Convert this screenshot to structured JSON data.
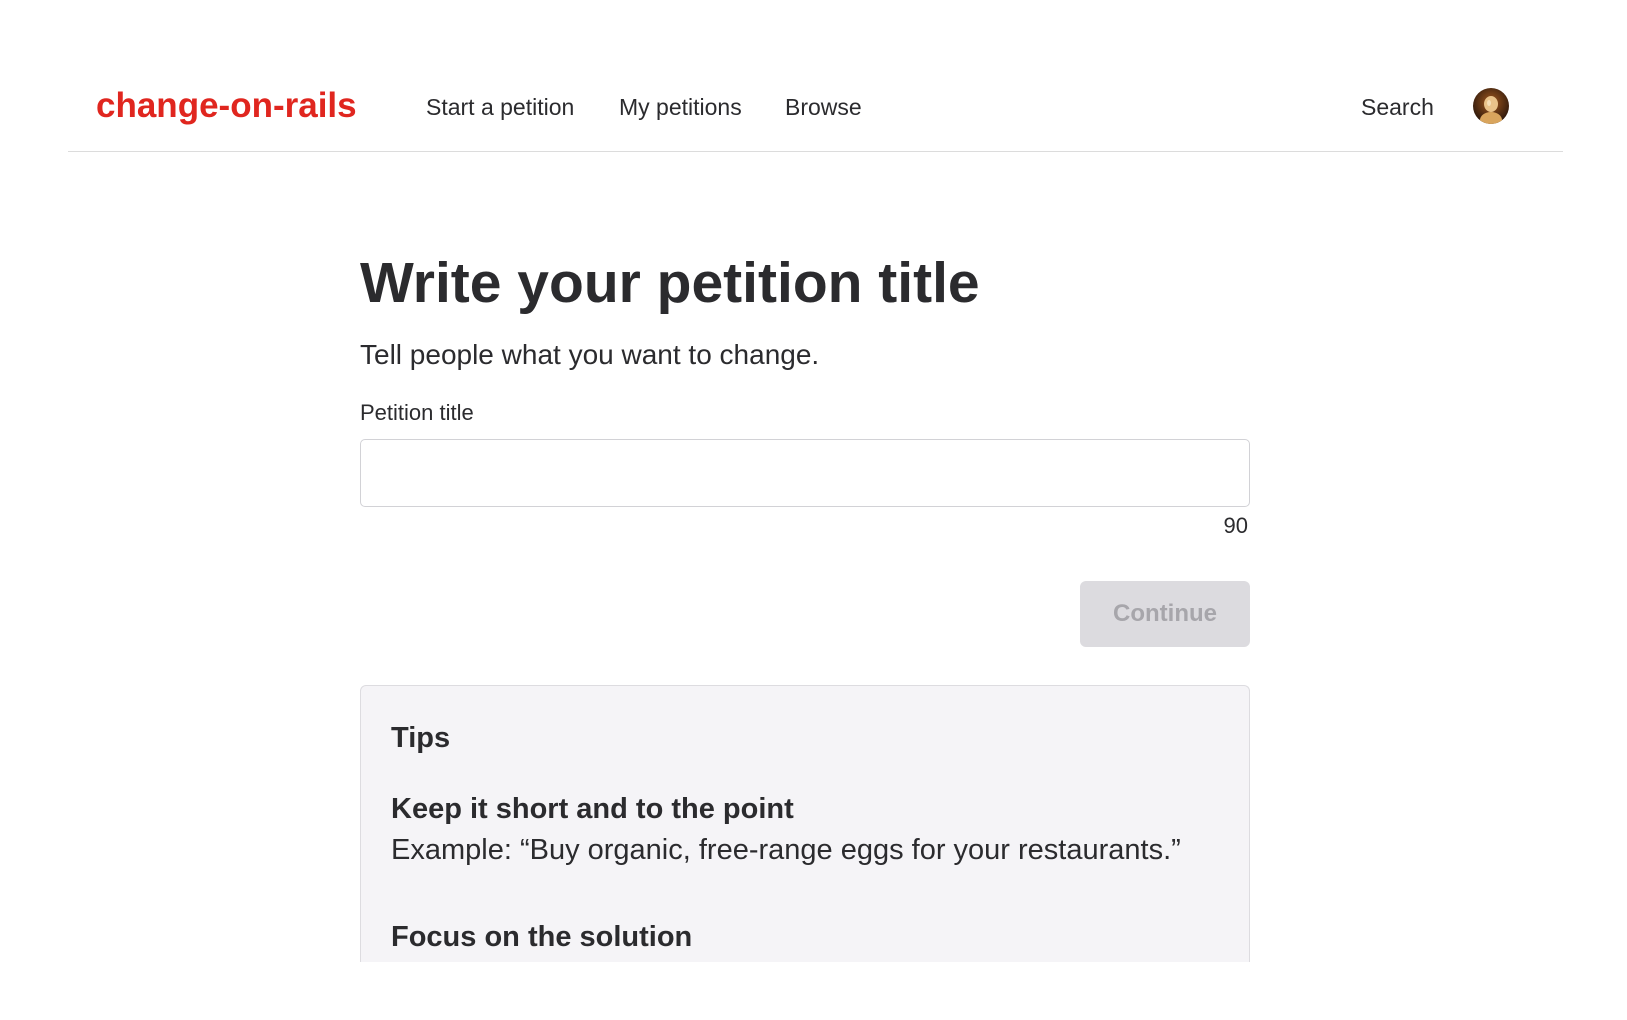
{
  "header": {
    "logo": "change-on-rails",
    "nav": {
      "start": "Start a petition",
      "my": "My petitions",
      "browse": "Browse"
    },
    "search": "Search"
  },
  "main": {
    "title": "Write your petition title",
    "subtitle": "Tell people what you want to change.",
    "field_label": "Petition title",
    "input_value": "",
    "char_count": "90",
    "continue_label": "Continue"
  },
  "tips": {
    "heading": "Tips",
    "items": [
      {
        "title": "Keep it short and to the point",
        "text": "Example: “Buy organic, free-range eggs for your restaurants.”"
      },
      {
        "title": "Focus on the solution"
      }
    ]
  },
  "colors": {
    "brand": "#e0261f",
    "text": "#2b2b2e",
    "button_disabled_bg": "#dcdbdf",
    "button_disabled_text": "#a7a6ab",
    "tips_bg": "#f5f4f7"
  },
  "icons": {
    "avatar": "user-avatar-icon"
  }
}
